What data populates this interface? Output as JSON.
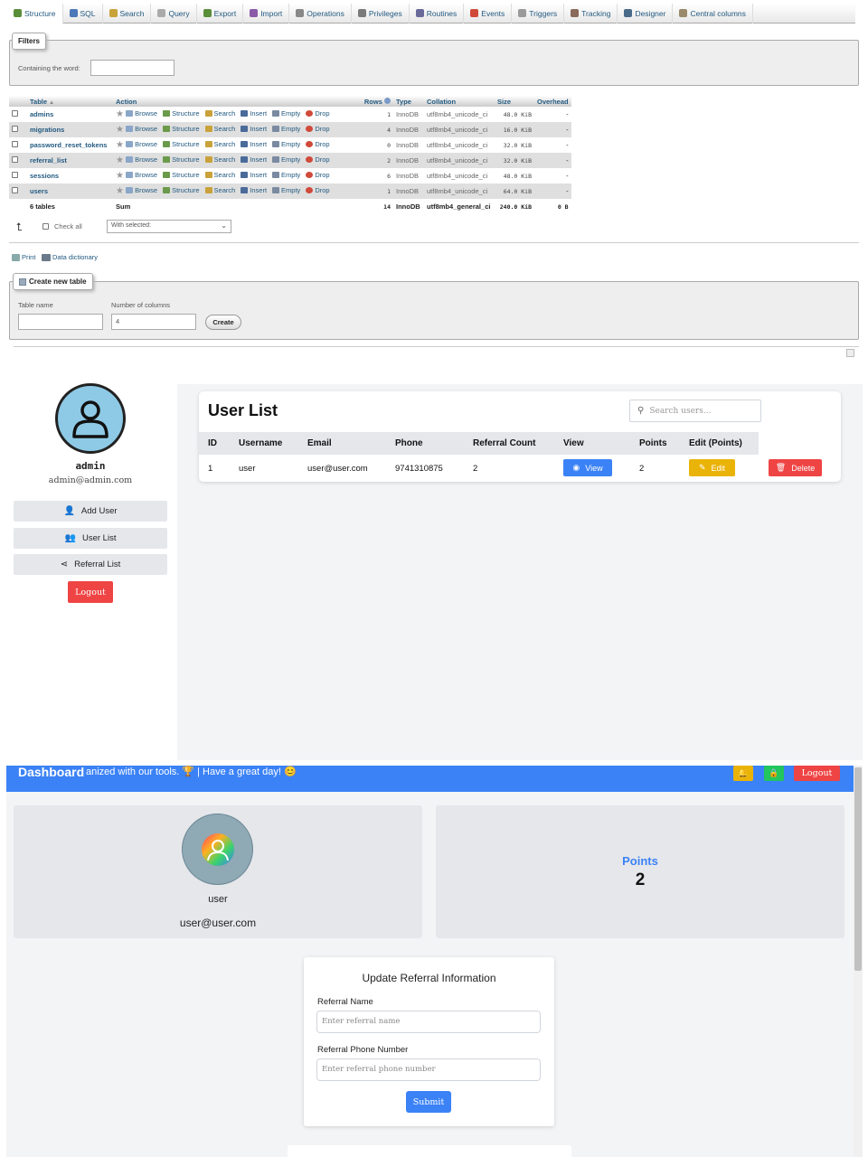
{
  "pma": {
    "tabs": [
      {
        "label": "Structure",
        "icon": "structure-icon",
        "color": "#5a8e3a"
      },
      {
        "label": "SQL",
        "icon": "sql-icon",
        "color": "#4a78b8"
      },
      {
        "label": "Search",
        "icon": "search-icon",
        "color": "#c9a23a"
      },
      {
        "label": "Query",
        "icon": "query-icon",
        "color": "#aaaaaa"
      },
      {
        "label": "Export",
        "icon": "export-icon",
        "color": "#5a8e3a"
      },
      {
        "label": "Import",
        "icon": "import-icon",
        "color": "#8a5aa8"
      },
      {
        "label": "Operations",
        "icon": "wrench-icon",
        "color": "#888888"
      },
      {
        "label": "Privileges",
        "icon": "privileges-icon",
        "color": "#7a7a7a"
      },
      {
        "label": "Routines",
        "icon": "routines-icon",
        "color": "#6a6a9a"
      },
      {
        "label": "Events",
        "icon": "clock-icon",
        "color": "#d04a3a"
      },
      {
        "label": "Triggers",
        "icon": "triggers-icon",
        "color": "#9a9a9a"
      },
      {
        "label": "Tracking",
        "icon": "eye-icon",
        "color": "#8a6a5a"
      },
      {
        "label": "Designer",
        "icon": "designer-icon",
        "color": "#4a6a8a"
      },
      {
        "label": "Central columns",
        "icon": "columns-icon",
        "color": "#9a8a6a"
      }
    ],
    "filters": {
      "legend": "Filters",
      "label": "Containing the word:"
    },
    "table": {
      "headers": [
        "Table",
        "Action",
        "Rows",
        "Type",
        "Collation",
        "Size",
        "Overhead"
      ],
      "actions": [
        "Browse",
        "Structure",
        "Search",
        "Insert",
        "Empty",
        "Drop"
      ],
      "rows": [
        {
          "name": "admins",
          "rows": "1",
          "type": "InnoDB",
          "collation": "utf8mb4_unicode_ci",
          "size": "48.0 KiB",
          "overhead": "-"
        },
        {
          "name": "migrations",
          "rows": "4",
          "type": "InnoDB",
          "collation": "utf8mb4_unicode_ci",
          "size": "16.0 KiB",
          "overhead": "-"
        },
        {
          "name": "password_reset_tokens",
          "rows": "0",
          "type": "InnoDB",
          "collation": "utf8mb4_unicode_ci",
          "size": "32.0 KiB",
          "overhead": "-"
        },
        {
          "name": "referral_list",
          "rows": "2",
          "type": "InnoDB",
          "collation": "utf8mb4_unicode_ci",
          "size": "32.0 KiB",
          "overhead": "-"
        },
        {
          "name": "sessions",
          "rows": "6",
          "type": "InnoDB",
          "collation": "utf8mb4_unicode_ci",
          "size": "48.0 KiB",
          "overhead": "-"
        },
        {
          "name": "users",
          "rows": "1",
          "type": "InnoDB",
          "collation": "utf8mb4_unicode_ci",
          "size": "64.0 KiB",
          "overhead": "-"
        }
      ],
      "summary": {
        "count": "6 tables",
        "sum": "Sum",
        "rows": "14",
        "type": "InnoDB",
        "collation": "utf8mb4_general_ci",
        "size": "240.0 KiB",
        "overhead": "0 B"
      }
    },
    "check_all": "Check all",
    "with_selected": "With selected:",
    "print": "Print",
    "data_dictionary": "Data dictionary",
    "create_table": {
      "legend": "Create new table",
      "name_label": "Table name",
      "columns_label": "Number of columns",
      "columns_value": "4",
      "button": "Create"
    }
  },
  "admin": {
    "profile": {
      "name": "admin",
      "email": "admin@admin.com"
    },
    "sidebar": [
      {
        "label": "Add User",
        "icon": "user-plus-icon"
      },
      {
        "label": "User List",
        "icon": "users-icon"
      },
      {
        "label": "Referral List",
        "icon": "share-icon"
      }
    ],
    "logout": "Logout",
    "user_list": {
      "title": "User List",
      "search_placeholder": "Search users...",
      "headers": [
        "ID",
        "Username",
        "Email",
        "Phone",
        "Referral Count",
        "View",
        "Points",
        "Edit (Points)"
      ],
      "rows": [
        {
          "id": "1",
          "username": "user",
          "email": "user@user.com",
          "phone": "9741310875",
          "referral_count": "2",
          "view": "View",
          "points": "2",
          "edit": "Edit",
          "delete": "Delete"
        }
      ]
    },
    "colors": {
      "view": "#3b82f6",
      "edit": "#eab308",
      "delete": "#ef4444",
      "logout": "#ef4444"
    }
  },
  "dashboard": {
    "title": "Dashboard",
    "marquee": "anized with our tools. 🏆 | Have a great day! 😊",
    "logout": "Logout",
    "user": {
      "name": "user",
      "email": "user@user.com"
    },
    "points": {
      "label": "Points",
      "value": "2"
    },
    "form": {
      "title": "Update Referral Information",
      "name_label": "Referral Name",
      "name_placeholder": "Enter referral name",
      "phone_label": "Referral Phone Number",
      "phone_placeholder": "Enter referral phone number",
      "submit": "Submit"
    },
    "colors": {
      "topbar": "#3b82f6",
      "bell": "#eab308",
      "lock": "#22c55e",
      "logout": "#ef4444",
      "points": "#3b82f6"
    }
  }
}
